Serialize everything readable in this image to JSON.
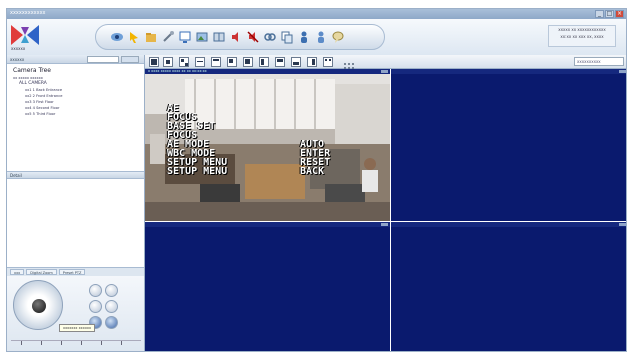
{
  "window": {
    "title": "xxxxxxxxxxxx"
  },
  "header": {
    "logo_label": "xxxxxx",
    "toolbar_icons": [
      "camera-icon",
      "cursor-icon",
      "folder-icon",
      "tools-icon",
      "monitor-icon",
      "photo-icon",
      "grid-icon",
      "speaker-icon",
      "mute-icon",
      "link-icon",
      "copy-icon",
      "person-icon",
      "person2-icon",
      "chat-icon"
    ],
    "info_line1": "xxxxx xx xxxxxxxxxxxx",
    "info_line2": "xx:xx xx xxx xx, xxxx"
  },
  "sidebar": {
    "header_label": "xxxxxx",
    "search_placeholder": "xxxxxx",
    "tree_title": "Camera Tree",
    "tree": [
      "xx xxxxx xxxxxx",
      "ALL CAMERA",
      "xx1 1 Back Entrance",
      "xx2 2 Front Entrance",
      "xx3 3 First Floor",
      "xx4 4 Second Floor",
      "xx5 5 Third Floor"
    ],
    "detail_label": "Detail",
    "ptz_tabs": [
      "xxx",
      "Digital Zoom",
      "Preset PTZ"
    ],
    "tooltip": "xxxxxxx xxxxxx"
  },
  "main": {
    "view_select": "xxxxxxxxxx",
    "cells": [
      {
        "caption": "x xxxx xxxxx   xxxx xx xx xx:xx:xx",
        "type": "video"
      },
      {
        "caption": "",
        "type": "empty"
      },
      {
        "caption": "",
        "type": "empty"
      },
      {
        "caption": "",
        "type": "empty"
      }
    ],
    "osd_left": [
      "AE",
      "FOCUS",
      "BASE SET",
      "FOCUS",
      "AE  MODE",
      "WBC  MODE",
      "SETUP  MENU",
      "SETUP  MENU"
    ],
    "osd_right": [
      "AUTO",
      "ENTER",
      "RESET",
      "BACK"
    ]
  },
  "colors": {
    "video_bg": "#0a1a6e",
    "chrome": "#e9eff6"
  }
}
